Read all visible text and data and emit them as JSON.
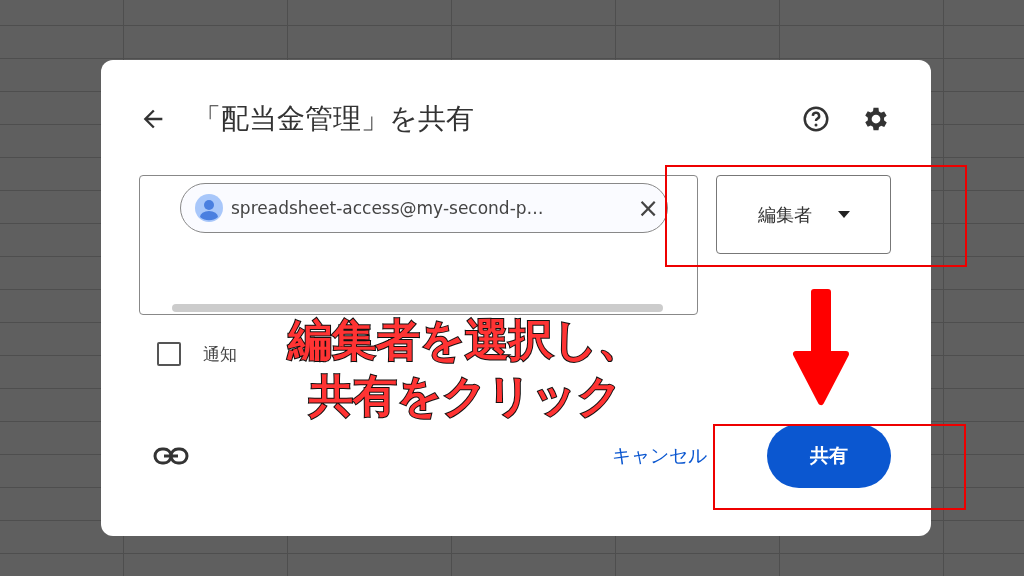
{
  "dialog": {
    "title": "「配当金管理」を共有",
    "recipient_chip": {
      "label": "spreadsheet-access@my-second-p…",
      "close": "×"
    },
    "role_dropdown": {
      "value": "編集者"
    },
    "notify": {
      "label": "通知",
      "checked": false
    },
    "buttons": {
      "cancel": "キャンセル",
      "share": "共有"
    }
  },
  "annotation": {
    "lines": [
      "編集者を選択し、",
      "共有をクリック"
    ]
  }
}
